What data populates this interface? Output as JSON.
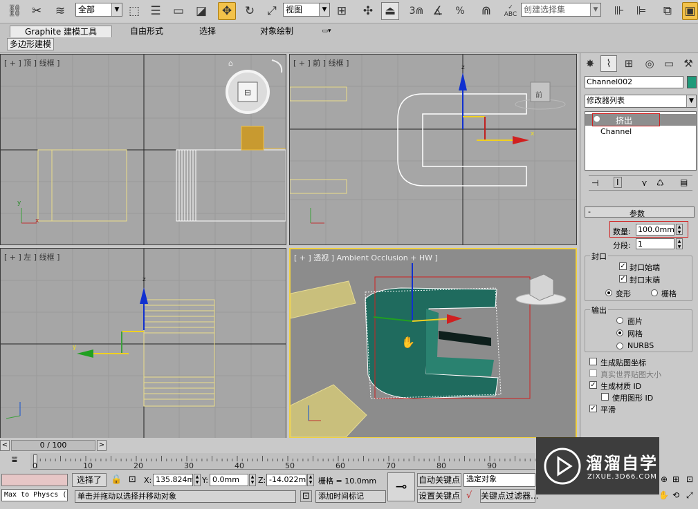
{
  "toolbar": {
    "selection_filter": "全部",
    "reference_coord": "视图",
    "named_selection_placeholder": "创建选择集",
    "snap_value": "3",
    "percent_label": "%",
    "abc_label": "ABC"
  },
  "ribbon": {
    "tabs": [
      "Graphite 建模工具",
      "自由形式",
      "选择",
      "对象绘制"
    ],
    "subtab": "多边形建模"
  },
  "viewports": {
    "top": "[ + ] 顶 ] 线框 ]",
    "front": "[ + ] 前 ] 线框 ]",
    "left": "[ + ] 左 ] 线框 ]",
    "perspective": "[ + ] 透视 ] Ambient Occlusion + HW ]",
    "front_viewcube": "前",
    "axis_x": "x",
    "axis_y": "y",
    "axis_z": "z"
  },
  "command_panel": {
    "object_name": "Channel002",
    "object_color": "#1f9a7a",
    "modifier_list": "修改器列表",
    "stack": [
      "挤出",
      "Channel"
    ],
    "rollout_title": "参数",
    "amount_label": "数量:",
    "amount_value": "100.0mm",
    "segments_label": "分段:",
    "segments_value": "1",
    "capping_group": "封口",
    "cap_start": "封口始端",
    "cap_end": "封口末端",
    "morph": "变形",
    "grid": "栅格",
    "output_group": "输出",
    "patch": "面片",
    "mesh": "网格",
    "nurbs": "NURBS",
    "gen_mapping": "生成贴图坐标",
    "real_world": "真实世界贴图大小",
    "gen_mat_id": "生成材质 ID",
    "use_shape_id": "使用图形 ID",
    "smooth": "平滑"
  },
  "timeline": {
    "frame_display": "0 / 100",
    "prev": "<",
    "next": ">",
    "ticks": [
      "0",
      "10",
      "20",
      "30",
      "40",
      "50",
      "60",
      "70",
      "80",
      "90"
    ]
  },
  "status": {
    "maxscript": "Max to Physcs (",
    "selected": "选择了",
    "x_label": "X:",
    "x_value": "135.824mm",
    "y_label": "Y:",
    "y_value": "0.0mm",
    "z_label": "Z:",
    "z_value": "-14.022mm",
    "grid": "栅格 = 10.0mm",
    "prompt": "单击并拖动以选择并移动对象",
    "add_time_tag": "添加时间标记",
    "auto_key": "自动关键点",
    "set_key": "设置关键点",
    "selected_object": "选定对象",
    "key_filters": "关键点过滤器..."
  },
  "watermark": {
    "title": "溜溜自学",
    "url": "ZIXUE.3D66.COM"
  }
}
